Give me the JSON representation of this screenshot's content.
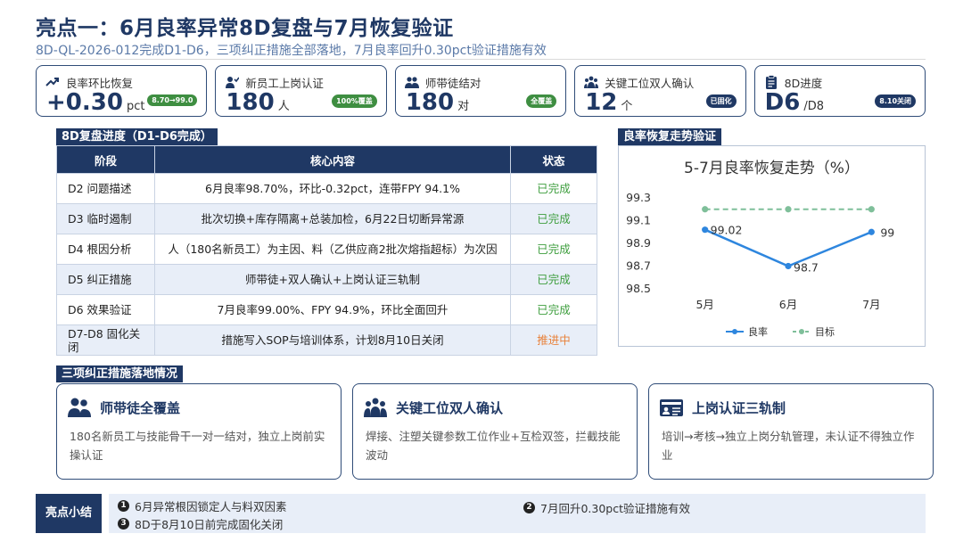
{
  "header": {
    "title": "亮点一：6月良率异常8D复盘与7月恢复验证",
    "subtitle": "8D-QL-2026-012完成D1-D6，三项纠正措施全部落地，7月良率回升0.30pct验证措施有效"
  },
  "kpis": [
    {
      "label": "良率环比恢复",
      "value": "+0.30",
      "unit": "pct",
      "badge": "8.70→99.0",
      "icon": "trend-up-icon"
    },
    {
      "label": "新员工上岗认证",
      "value": "180",
      "unit": "人",
      "badge": "100%覆盖",
      "icon": "user-check-icon"
    },
    {
      "label": "师带徒结对",
      "value": "180",
      "unit": "对",
      "badge": "全覆盖",
      "icon": "users-icon"
    },
    {
      "label": "关键工位双人确认",
      "value": "12",
      "unit": "个",
      "badge": "已固化",
      "icon": "team-icon"
    },
    {
      "label": "8D进度",
      "value": "D6",
      "unit": "/D8",
      "badge": "8.10关闭",
      "icon": "clipboard-icon"
    }
  ],
  "progress": {
    "section_label": "8D复盘进度（D1-D6完成）",
    "headers": [
      "阶段",
      "核心内容",
      "状态"
    ],
    "rows": [
      {
        "stage": "D2 问题描述",
        "content": "6月良率98.70%，环比-0.32pct，连带FPY 94.1%",
        "status": "已完成",
        "done": true
      },
      {
        "stage": "D3 临时遏制",
        "content": "批次切换+库存隔离+总装加检，6月22日切断异常源",
        "status": "已完成",
        "done": true
      },
      {
        "stage": "D4 根因分析",
        "content": "人（180名新员工）为主因、料（乙供应商2批次熔指超标）为次因",
        "status": "已完成",
        "done": true
      },
      {
        "stage": "D5 纠正措施",
        "content": "师带徒+双人确认+上岗认证三轨制",
        "status": "已完成",
        "done": true
      },
      {
        "stage": "D6 效果验证",
        "content": "7月良率99.00%、FPY 94.9%，环比全面回升",
        "status": "已完成",
        "done": true
      },
      {
        "stage": "D7-D8 固化关闭",
        "content": "措施写入SOP与培训体系，计划8月10日关闭",
        "status": "推进中",
        "done": false
      }
    ]
  },
  "chart": {
    "section_label": "良率恢复走势验证",
    "title": "5-7月良率恢复走势（%）"
  },
  "chart_data": {
    "type": "line",
    "title": "5-7月良率恢复走势（%）",
    "categories": [
      "5月",
      "6月",
      "7月"
    ],
    "series": [
      {
        "name": "良率",
        "values": [
          99.02,
          98.7,
          99
        ],
        "color": "#2e86de",
        "labels": [
          "99.02",
          "98.7",
          "99"
        ]
      },
      {
        "name": "目标",
        "values": [
          99.2,
          99.2,
          99.2
        ],
        "color": "#7fbf9a",
        "dashed": true
      }
    ],
    "ylim": [
      98.5,
      99.3
    ],
    "yticks": [
      "98.5",
      "98.7",
      "98.9",
      "99.1",
      "99.3"
    ],
    "grid": false,
    "legend": "bottom"
  },
  "measures": {
    "section_label": "三项纠正措施落地情况",
    "cards": [
      {
        "title": "师带徒全覆盖",
        "desc": "180名新员工与技能骨干一对一结对，独立上岗前实操认证",
        "icon": "users-icon"
      },
      {
        "title": "关键工位双人确认",
        "desc": "焊接、注塑关键参数工位作业+互检双签，拦截技能波动",
        "icon": "team-icon"
      },
      {
        "title": "上岗认证三轨制",
        "desc": "培训→考核→独立上岗分轨管理，未认证不得独立作业",
        "icon": "id-card-icon"
      }
    ]
  },
  "summary": {
    "label": "亮点小结",
    "items": [
      {
        "num": "1",
        "text": "6月异常根因锁定人与料双因素"
      },
      {
        "num": "2",
        "text": "7月回升0.30pct验证措施有效"
      },
      {
        "num": "3",
        "text": "8D于8月10日前完成固化关闭"
      }
    ]
  }
}
